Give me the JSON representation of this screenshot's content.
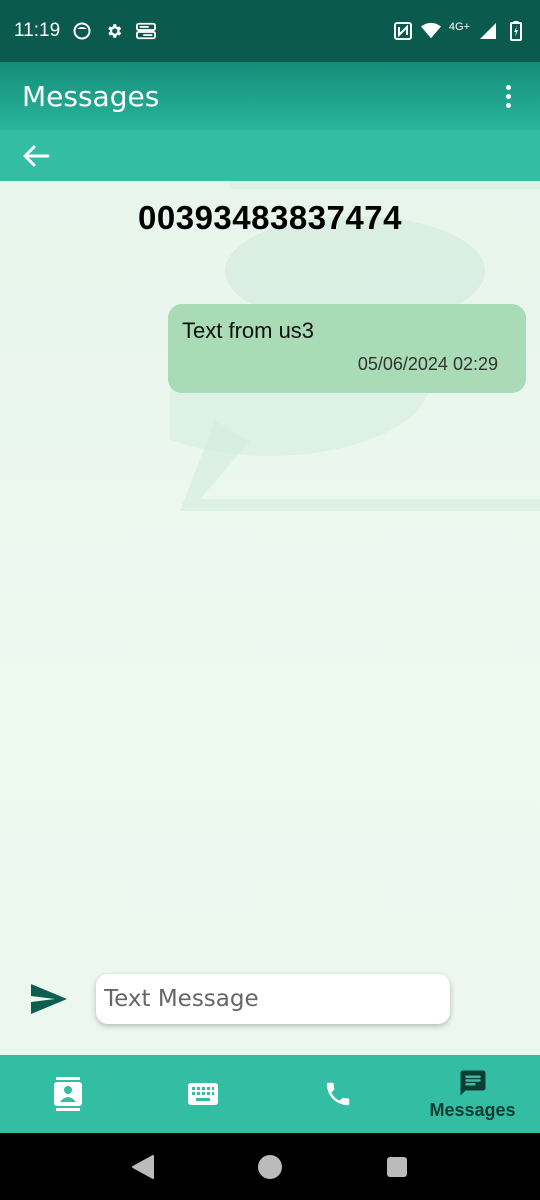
{
  "status_bar": {
    "time": "11:19",
    "network": "4G+",
    "icons": [
      "face-notification-icon",
      "settings-gear-icon",
      "storage-sync-icon",
      "nfc-icon",
      "wifi-icon",
      "signal-icon",
      "battery-icon"
    ]
  },
  "app_bar": {
    "title": "Messages",
    "menu_icon": "more-vert-icon"
  },
  "nav_bar": {
    "back_icon": "back-arrow-icon"
  },
  "conversation": {
    "contact_number": "00393483837474",
    "messages": [
      {
        "text": "Text from us3",
        "timestamp": "05/06/2024 02:29",
        "direction": "outgoing"
      }
    ]
  },
  "composer": {
    "placeholder": "Text Message",
    "value": "",
    "send_icon": "send-icon"
  },
  "bottom_nav": {
    "items": [
      {
        "icon": "contacts-icon",
        "label": ""
      },
      {
        "icon": "dialpad-keyboard-icon",
        "label": ""
      },
      {
        "icon": "phone-icon",
        "label": ""
      },
      {
        "icon": "message-icon",
        "label": "Messages",
        "active": true
      }
    ]
  },
  "colors": {
    "status_bar": "#0b5a4e",
    "app_bar": "#2ab49b",
    "nav_bar": "#33bea4",
    "bubble": "#a8dbb6",
    "background": "#eef9f0",
    "icon_dark": "#0c5e4f"
  }
}
